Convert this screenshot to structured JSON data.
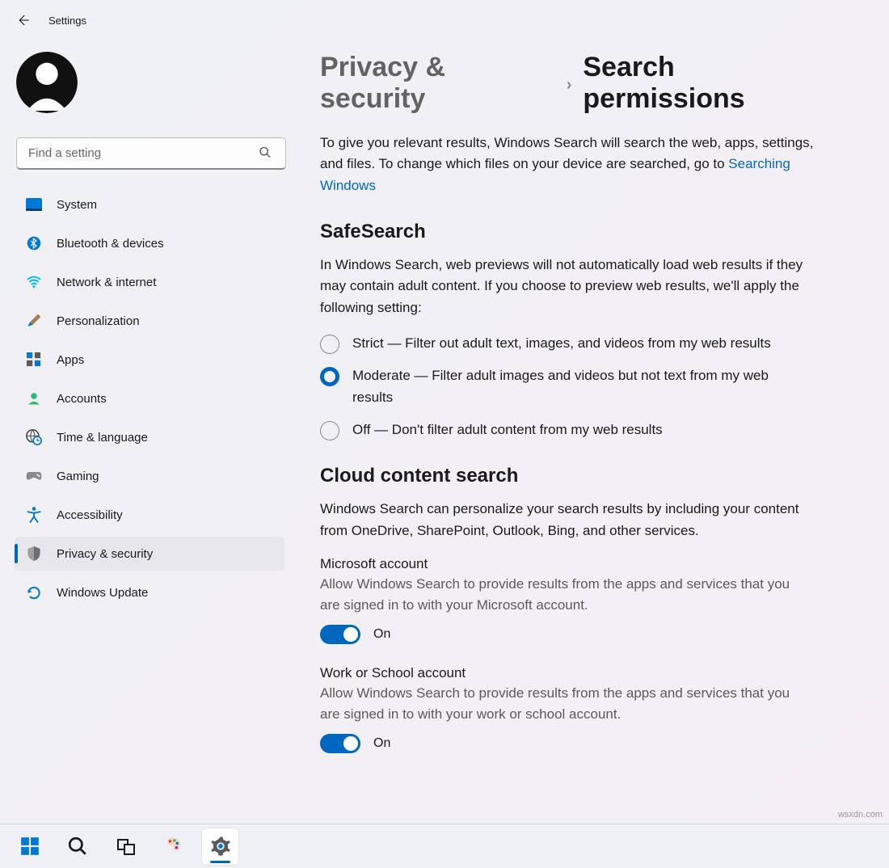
{
  "title": "Settings",
  "search": {
    "placeholder": "Find a setting"
  },
  "sidebar": {
    "items": [
      {
        "id": "system",
        "label": "System"
      },
      {
        "id": "bluetooth",
        "label": "Bluetooth & devices"
      },
      {
        "id": "network",
        "label": "Network & internet"
      },
      {
        "id": "personalization",
        "label": "Personalization"
      },
      {
        "id": "apps",
        "label": "Apps"
      },
      {
        "id": "accounts",
        "label": "Accounts"
      },
      {
        "id": "time",
        "label": "Time & language"
      },
      {
        "id": "gaming",
        "label": "Gaming"
      },
      {
        "id": "accessibility",
        "label": "Accessibility"
      },
      {
        "id": "privacy",
        "label": "Privacy & security",
        "active": true
      },
      {
        "id": "update",
        "label": "Windows Update"
      }
    ]
  },
  "breadcrumb": {
    "parent": "Privacy & security",
    "current": "Search permissions"
  },
  "intro": {
    "pre": "To give you relevant results, Windows Search will search the web, apps, settings, and files. To change which files on your device are searched, go to ",
    "link": "Searching Windows"
  },
  "safesearch": {
    "heading": "SafeSearch",
    "desc": "In Windows Search, web previews will not automatically load web results if they may contain adult content. If you choose to preview web results, we'll apply the following setting:",
    "options": [
      {
        "id": "strict",
        "label": "Strict — Filter out adult text, images, and videos from my web results",
        "selected": false
      },
      {
        "id": "moderate",
        "label": "Moderate — Filter adult images and videos but not text from my web results",
        "selected": true
      },
      {
        "id": "off",
        "label": "Off — Don't filter adult content from my web results",
        "selected": false
      }
    ]
  },
  "cloud": {
    "heading": "Cloud content search",
    "desc": "Windows Search can personalize your search results by including your content from OneDrive, SharePoint, Outlook, Bing, and other services.",
    "groups": [
      {
        "title": "Microsoft account",
        "desc": "Allow Windows Search to provide results from the apps and services that you are signed in to with your Microsoft account.",
        "state": "On"
      },
      {
        "title": "Work or School account",
        "desc": "Allow Windows Search to provide results from the apps and services that you are signed in to with your work or school account.",
        "state": "On"
      }
    ]
  },
  "watermark": "wsxdn.com"
}
